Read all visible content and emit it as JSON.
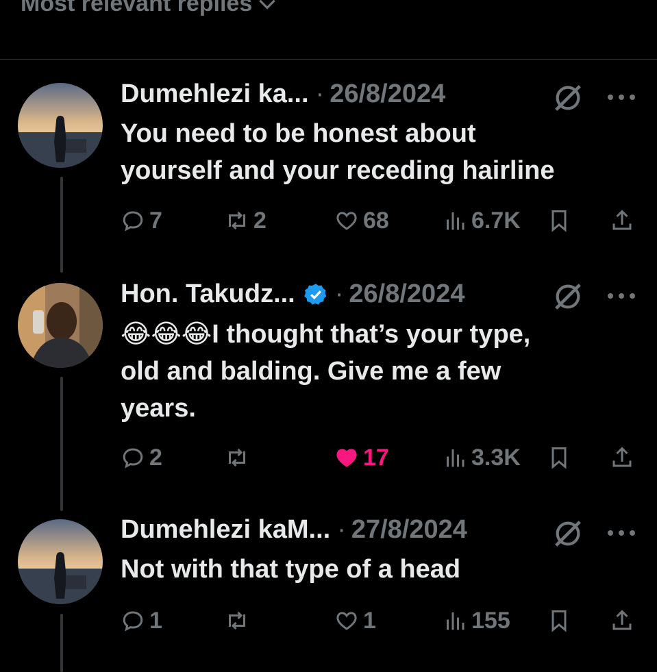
{
  "header": {
    "sort_label": "Most relevant replies"
  },
  "colors": {
    "background": "#000000",
    "text": "#e7e9ea",
    "muted": "#71767b",
    "like_active": "#f91880",
    "verified": "#1d9bf0"
  },
  "replies": [
    {
      "name": "Dumehlezi ka...",
      "separator": "·",
      "date": "26/8/2024",
      "verified": false,
      "text_lines": [
        "You need to be honest about",
        "yourself and your receding hairline"
      ],
      "replies_count": "7",
      "reposts_count": "2",
      "likes_count": "68",
      "liked": false,
      "views_count": "6.7K"
    },
    {
      "name": "Hon. Takudz...",
      "separator": "·",
      "date": "26/8/2024",
      "verified": true,
      "emoji_prefix": "😂😂😂",
      "text_lines": [
        "I thought that’s your type,",
        "old and balding. Give me a few",
        "years."
      ],
      "replies_count": "2",
      "reposts_count": "",
      "likes_count": "17",
      "liked": true,
      "views_count": "3.3K"
    },
    {
      "name": "Dumehlezi kaM...",
      "separator": "·",
      "date": "27/8/2024",
      "verified": false,
      "text_lines": [
        "Not with that type of a head"
      ],
      "replies_count": "1",
      "reposts_count": "",
      "likes_count": "1",
      "liked": false,
      "views_count": "155"
    }
  ],
  "icons": [
    "chevron-down-icon",
    "grok-icon",
    "more-icon",
    "reply-icon",
    "repost-icon",
    "like-icon",
    "views-icon",
    "bookmark-icon",
    "share-icon",
    "verified-badge-icon",
    "laughing-emoji"
  ]
}
